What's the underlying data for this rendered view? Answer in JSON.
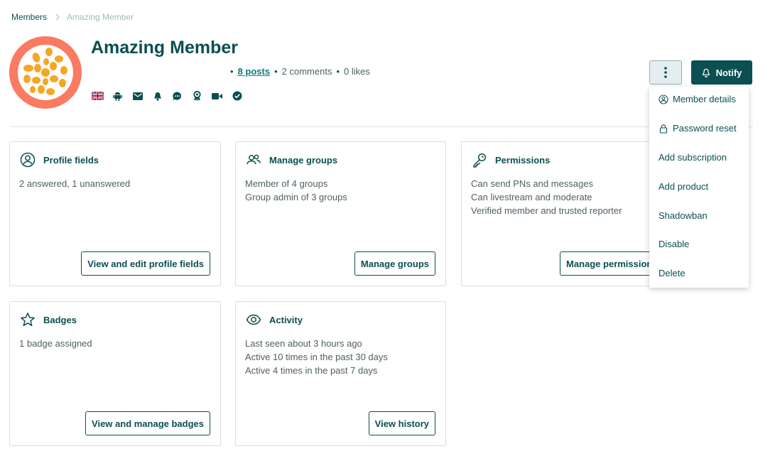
{
  "breadcrumb": {
    "parent": "Members",
    "current": "Amazing Member"
  },
  "member": {
    "name": "Amazing Member"
  },
  "stats": {
    "posts": "8 posts",
    "comments": "2 comments",
    "likes": "0 likes",
    "separator": "•"
  },
  "status_icons": [
    "uk-flag-icon",
    "android-icon",
    "email-icon",
    "bell-icon",
    "chat-bubble-icon",
    "award-ribbon-icon",
    "video-camera-icon",
    "verified-check-icon"
  ],
  "header_actions": {
    "notify_label": "Notify"
  },
  "menu": {
    "items": [
      "Member details",
      "Password reset",
      "Add subscription",
      "Add product",
      "Shadowban",
      "Disable",
      "Delete"
    ]
  },
  "cards": {
    "profile": {
      "title": "Profile fields",
      "lines": [
        "2 answered, 1 unanswered"
      ],
      "button": "View and edit profile fields"
    },
    "groups": {
      "title": "Manage groups",
      "lines": [
        "Member of 4 groups",
        "Group admin of 3 groups"
      ],
      "button": "Manage groups"
    },
    "permissions": {
      "title": "Permissions",
      "lines": [
        "Can send PNs and messages",
        "Can livestream and moderate",
        "Verified member and trusted reporter"
      ],
      "button": "Manage permissions"
    },
    "badges": {
      "title": "Badges",
      "lines": [
        "1 badge assigned"
      ],
      "button": "View and manage badges"
    },
    "activity": {
      "title": "Activity",
      "lines": [
        "Last seen about 3 hours ago",
        "Active 10 times in the past 30 days",
        "Active 4 times in the past 7 days"
      ],
      "button": "View history"
    }
  },
  "colors": {
    "primary": "#0b4f52",
    "avatar_bg": "#fb7a62",
    "avatar_spot": "#f5a623",
    "text_muted": "#4f5f62",
    "link": "#0b7a7d"
  }
}
